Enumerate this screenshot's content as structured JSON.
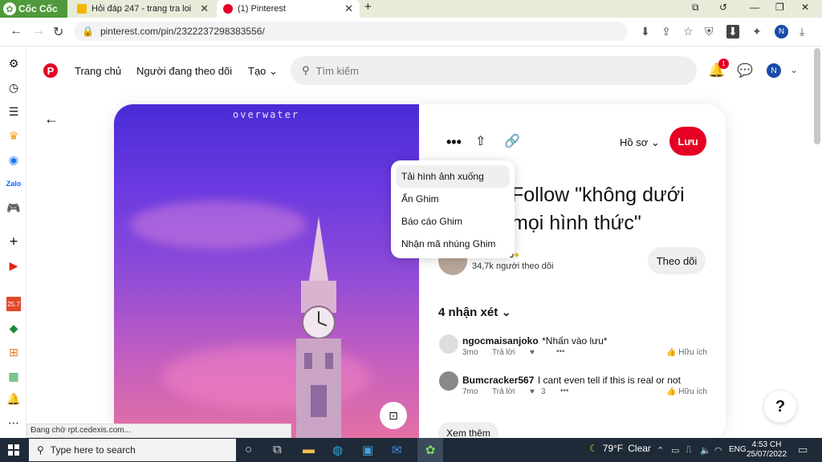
{
  "browser": {
    "brand": "Cốc Cốc",
    "tabs": [
      {
        "title": "Hỏi đáp 247 - trang tra loi",
        "icon": "hoidap-icon"
      },
      {
        "title": "(1) Pinterest",
        "icon": "pinterest-icon"
      }
    ],
    "url": "pinterest.com/pin/2322237298383556/",
    "status_text": "Đang chờ rpt.cedexis.com..."
  },
  "pinterest": {
    "nav": {
      "home": "Trang chủ",
      "following": "Người đang theo dõi",
      "create": "Tạo"
    },
    "search_placeholder": "Tìm kiếm",
    "notification_count": "1",
    "user_initial": "N"
  },
  "pin": {
    "image_caption": "overwater",
    "board_label": "Hồ sơ",
    "save_label": "Lưu",
    "title": "Follow \"không dưới mọi hình thức\"",
    "author_name_fragment": "tree",
    "followers": "34,7k người theo dõi",
    "follow_label": "Theo dõi",
    "comments_header": "4 nhận xét",
    "comments": [
      {
        "user": "ngocmaisanjoko",
        "text": "*Nhấn vào lưu*",
        "time": "3mo",
        "reply": "Trả lời",
        "likes": "",
        "helpful": "Hữu ích"
      },
      {
        "user": "Bumcracker567",
        "text": "I cant even tell if this is real or not",
        "time": "7mo",
        "reply": "Trả lời",
        "likes": "3",
        "helpful": "Hữu ích"
      }
    ],
    "see_more": "Xem thêm"
  },
  "menu": {
    "items": [
      "Tải hình ảnh xuống",
      "Ẩn Ghim",
      "Báo cáo Ghim",
      "Nhận mã nhúng Ghim"
    ],
    "active_index": 0
  },
  "taskbar": {
    "search_placeholder": "Type here to search",
    "weather_temp": "79°F",
    "weather_desc": "Clear",
    "lang": "ENG",
    "time": "4:53 CH",
    "date": "25/07/2022"
  },
  "colors": {
    "pinterest_red": "#e60023",
    "browser_green": "#4f9a3a"
  }
}
